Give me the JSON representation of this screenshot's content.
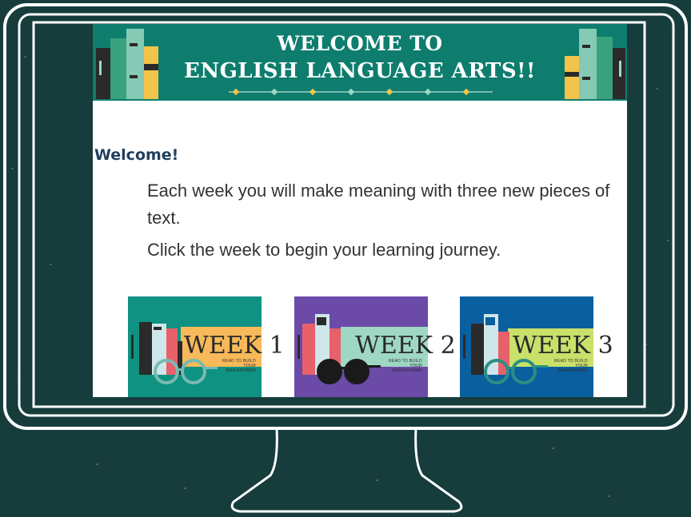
{
  "banner": {
    "title_line1": "WELCOME TO",
    "title_line2": "ENGLISH LANGUAGE ARTS!!"
  },
  "content": {
    "heading": "Welcome!",
    "paragraph1": "Each week you will make meaning with three new pieces of text.",
    "paragraph2": "Click the week to begin your learning journey."
  },
  "weeks": [
    {
      "label": "WEEK 1",
      "subtitle": "READ TO BUILD YOUR BRAINPOWER",
      "bg_color": "#0f9281",
      "band_color": "#f8b95a",
      "glasses_color": "#79b9b0"
    },
    {
      "label": "WEEK 2",
      "subtitle": "READ TO BUILD YOUR BRAINPOWER",
      "bg_color": "#6b4aa8",
      "band_color": "#9ed8c3",
      "glasses_color": "#1a1a1a"
    },
    {
      "label": "WEEK 3",
      "subtitle": "READ TO BUILD YOUR BRAINPOWER",
      "bg_color": "#0a5f9e",
      "band_color": "#c9e06a",
      "glasses_color": "#2a8f84"
    }
  ],
  "colors": {
    "background": "#163c3c",
    "chalk": "#ffffff",
    "banner": "#0e7d6e",
    "heading": "#1f3f5c",
    "text": "#333333"
  }
}
